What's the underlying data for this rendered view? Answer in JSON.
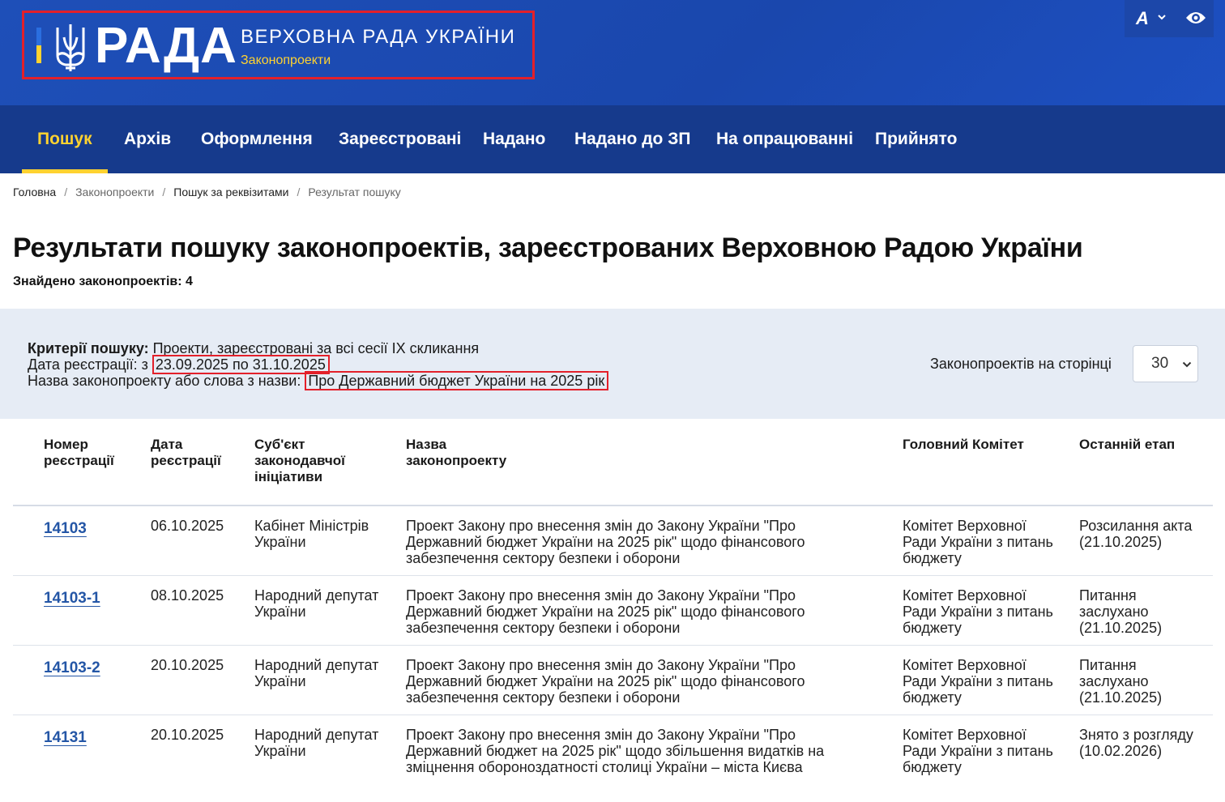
{
  "header": {
    "rada_word": "РАДА",
    "site_title": "ВЕРХОВНА РАДА УКРАЇНИ",
    "site_subtitle": "Законопроекти",
    "font_button": "A",
    "icons": [
      "trident-icon",
      "chevron-down-icon",
      "eye-icon"
    ],
    "colors": {
      "brand_blue": "#1e4fb8",
      "nav_blue": "#163a8c",
      "accent_yellow": "#ffd230",
      "highlight_red": "#e3202a",
      "link_blue": "#2456a6"
    }
  },
  "nav": {
    "items": [
      {
        "label": "Пошук",
        "active": true
      },
      {
        "label": "Архів"
      },
      {
        "label": "Оформлення"
      },
      {
        "label": "Зареєстровані"
      },
      {
        "label": "Надано"
      },
      {
        "label": "Надано до ЗП"
      },
      {
        "label": "На опрацюванні"
      },
      {
        "label": "Прийнято"
      }
    ]
  },
  "breadcrumb": [
    "Головна",
    "Законопроекти",
    "Пошук за реквізитами",
    "Результат пошуку"
  ],
  "page": {
    "title": "Результати пошуку законопроектів, зареєстрованих Верховною Радою України",
    "found_label": "Знайдено законопроектів: 4"
  },
  "criteria": {
    "label": "Критерії пошуку:",
    "value": " Проекти, зареєстровані за всі сесії IX скликання",
    "date_label": "Дата реєстрації: з ",
    "date_value": "23.09.2025 по 31.10.2025",
    "name_label": "Назва законопроекту або слова з назви: ",
    "name_value": "Про Державний бюджет України на 2025 рік",
    "per_page_label": "Законопроектів на сторінці",
    "per_page_value": "30"
  },
  "table": {
    "headers": {
      "number": [
        "Номер",
        "реєстрації"
      ],
      "date": [
        "Дата",
        "реєстрації"
      ],
      "subject": [
        "Суб'єкт",
        "законодавчої",
        "ініціативи"
      ],
      "name": [
        "Назва",
        "законопроекту"
      ],
      "committee": [
        "Головний Комітет"
      ],
      "stage": [
        "Останній етап"
      ]
    },
    "rows": [
      {
        "number": "14103",
        "date": "06.10.2025",
        "subject": [
          "Кабінет Міністрів",
          "України"
        ],
        "name": [
          "Проект Закону про внесення змін до Закону України \"Про",
          "Державний бюджет України на 2025 рік\" щодо фінансового",
          "забезпечення сектору безпеки і оборони"
        ],
        "committee": [
          "Комітет Верховної",
          "Ради України з питань",
          "бюджету"
        ],
        "stage": [
          "Розсилання акта",
          "(21.10.2025)"
        ]
      },
      {
        "number": "14103-1",
        "date": "08.10.2025",
        "subject": [
          "Народний депутат",
          "України"
        ],
        "name": [
          "Проект Закону про внесення змін до Закону України \"Про",
          "Державний бюджет України на 2025 рік\" щодо фінансового",
          "забезпечення сектору безпеки і оборони"
        ],
        "committee": [
          "Комітет Верховної",
          "Ради України з питань",
          "бюджету"
        ],
        "stage": [
          "Питання",
          "заслухано",
          "(21.10.2025)"
        ]
      },
      {
        "number": "14103-2",
        "date": "20.10.2025",
        "subject": [
          "Народний депутат",
          "України"
        ],
        "name": [
          "Проект Закону про внесення змін до Закону України \"Про",
          "Державний бюджет України на 2025 рік\" щодо фінансового",
          "забезпечення сектору безпеки і оборони"
        ],
        "committee": [
          "Комітет Верховної",
          "Ради України з питань",
          "бюджету"
        ],
        "stage": [
          "Питання",
          "заслухано",
          "(21.10.2025)"
        ]
      },
      {
        "number": "14131",
        "date": "20.10.2025",
        "subject": [
          "Народний депутат",
          "України"
        ],
        "name": [
          "Проект Закону про внесення змін до Закону України \"Про",
          "Державний бюджет на 2025 рік\" щодо збільшення видатків на",
          "зміцнення обороноздатності столиці України – міста Києва"
        ],
        "committee": [
          "Комітет Верховної",
          "Ради України з питань",
          "бюджету"
        ],
        "stage": [
          "Знято з розгляду",
          "(10.02.2026)"
        ]
      }
    ]
  }
}
